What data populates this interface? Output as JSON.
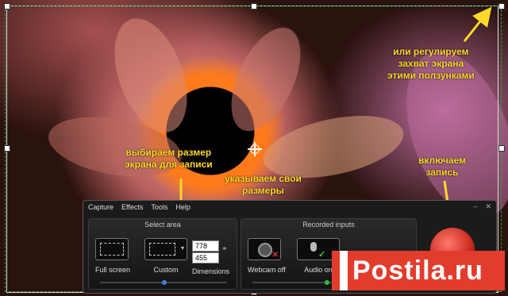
{
  "annotations": {
    "right_top": [
      "или регулируем",
      "захват экрана",
      "этими ползунками"
    ],
    "select_size": [
      "выбираем размер",
      "экрана для записи"
    ],
    "dimensions": [
      "указываем свои",
      "размеры"
    ],
    "record": [
      "включаем",
      "запись"
    ]
  },
  "menu": [
    "Capture",
    "Effects",
    "Tools",
    "Help"
  ],
  "window_controls": [
    "–",
    "✕"
  ],
  "select_area": {
    "title": "Select area",
    "full_screen_label": "Full screen",
    "custom_label": "Custom",
    "dimensions_label": "Dimensions",
    "width_value": "778",
    "height_value": "455"
  },
  "recorded_inputs": {
    "title": "Recorded inputs",
    "webcam_label": "Webcam off",
    "audio_label": "Audio on"
  },
  "logo": {
    "text": "Postila.ru"
  },
  "colors": {
    "annotation": "#ffd92a",
    "logo_bg": "#e23c2d",
    "frame": "#1fae3a"
  }
}
